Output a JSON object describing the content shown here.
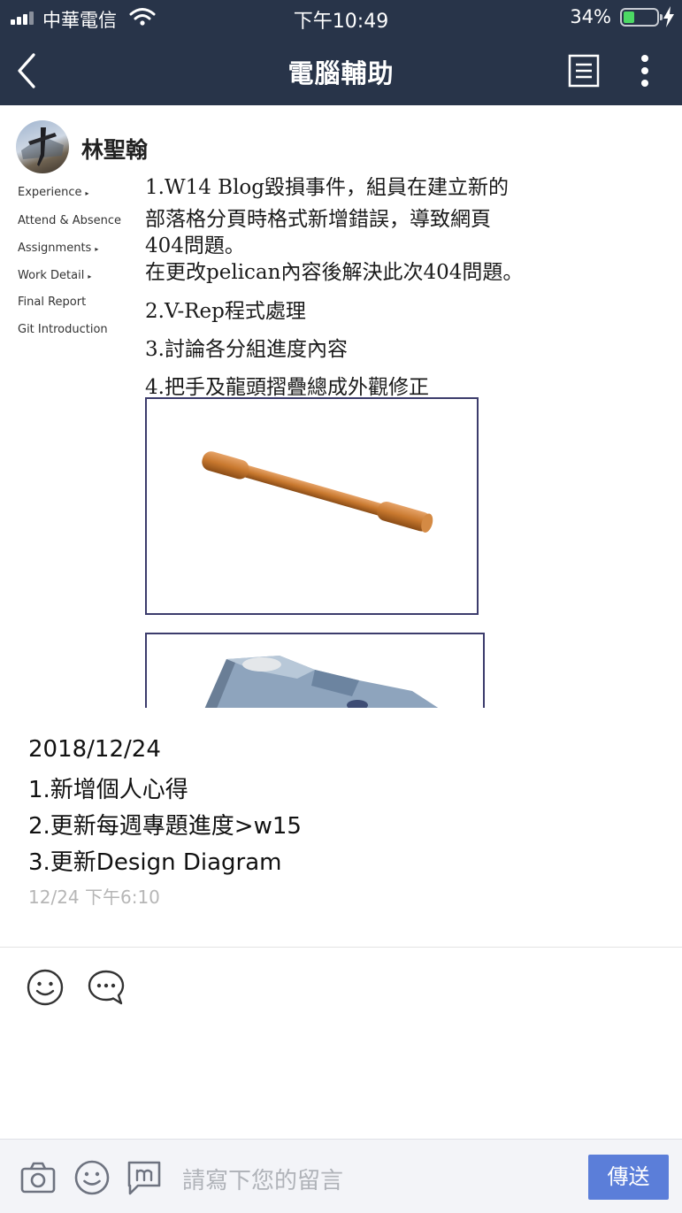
{
  "status_bar": {
    "carrier": "中華電信",
    "time": "下午10:49",
    "battery_percent": "34%",
    "battery_level": 0.34
  },
  "nav": {
    "title": "電腦輔助",
    "back_icon": "chevron-left-icon",
    "note_icon": "note-list-icon",
    "more_icon": "more-vertical-icon"
  },
  "post": {
    "author": "林聖翰",
    "image": {
      "sidebar_items": [
        "Experience",
        "Attend & Absence",
        "Assignments",
        "Work Detail",
        "Final Report",
        "Git Introduction"
      ],
      "doc_lines": [
        "1.W14 Blog毀損事件，組員在建立新的",
        "部落格分頁時格式新增錯誤，導致網頁",
        "404問題。",
        "在更改pelican內容後解決此次404問題。",
        "2.V-Rep程式處理",
        "3.討論各分組進度內容",
        "4.把手及龍頭摺疊總成外觀修正"
      ]
    },
    "text_lines": [
      "2018/12/24",
      "1.新增個人心得",
      "2.更新每週專題進度>w15",
      "3.更新Design Diagram"
    ],
    "timestamp": "12/24 下午6:10"
  },
  "reactions": {
    "emoji_icon": "smiley-icon",
    "comment_icon": "comment-bubble-icon"
  },
  "composer": {
    "placeholder": "請寫下您的留言",
    "send_label": "傳送",
    "camera_icon": "camera-icon",
    "sticker_icon": "smiley-icon",
    "meme_icon": "meme-sticker-icon"
  }
}
